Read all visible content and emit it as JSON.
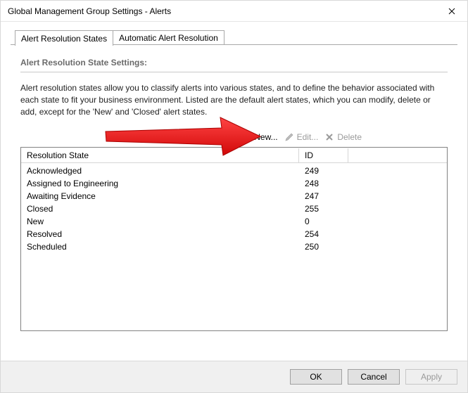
{
  "window": {
    "title": "Global Management Group Settings - Alerts"
  },
  "tabs": {
    "items": [
      {
        "label": "Alert Resolution States",
        "active": true
      },
      {
        "label": "Automatic Alert Resolution",
        "active": false
      }
    ]
  },
  "section": {
    "title": "Alert Resolution State Settings:",
    "description": "Alert resolution states allow you to classify alerts into various states, and to define the behavior associated with each state to fit your business environment. Listed are the default alert states, which you can modify, delete or add, except for the 'New' and 'Closed' alert states."
  },
  "toolbar": {
    "new_label": "New...",
    "edit_label": "Edit...",
    "delete_label": "Delete"
  },
  "grid": {
    "columns": {
      "state": "Resolution State",
      "id": "ID"
    },
    "rows": [
      {
        "state": "Acknowledged",
        "id": "249"
      },
      {
        "state": "Assigned to Engineering",
        "id": "248"
      },
      {
        "state": "Awaiting Evidence",
        "id": "247"
      },
      {
        "state": "Closed",
        "id": "255"
      },
      {
        "state": "New",
        "id": "0"
      },
      {
        "state": "Resolved",
        "id": "254"
      },
      {
        "state": "Scheduled",
        "id": "250"
      }
    ]
  },
  "buttons": {
    "ok": "OK",
    "cancel": "Cancel",
    "apply": "Apply"
  },
  "annotation": {
    "arrow_color": "#ed1c24"
  }
}
